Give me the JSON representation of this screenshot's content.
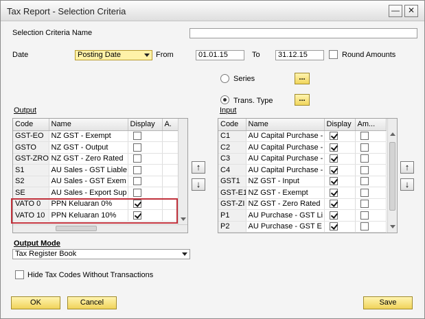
{
  "window": {
    "title": "Tax Report - Selection Criteria"
  },
  "criteria": {
    "name_label": "Selection Criteria Name",
    "name_value": "",
    "date_label": "Date",
    "date_type": "Posting Date",
    "from_label": "From",
    "from_value": "01.01.15",
    "to_label": "To",
    "to_value": "31.12.15",
    "round_amounts_label": "Round Amounts",
    "round_amounts_checked": false,
    "series_label": "Series",
    "trans_type_label": "Trans. Type",
    "selected_radio": "trans_type",
    "ellipsis": "..."
  },
  "output": {
    "heading": "Output",
    "columns": [
      "Code",
      "Name",
      "Display",
      "A."
    ],
    "rows": [
      {
        "code": "GST-EO",
        "name": "NZ GST - Exempt",
        "display": false
      },
      {
        "code": "GSTO",
        "name": "NZ GST - Output",
        "display": false
      },
      {
        "code": "GST-ZRO",
        "name": "NZ GST - Zero Rated",
        "display": false
      },
      {
        "code": "S1",
        "name": "AU Sales - GST Liable",
        "display": false
      },
      {
        "code": "S2",
        "name": "AU Sales - GST Exem",
        "display": false
      },
      {
        "code": "SE",
        "name": "AU Sales - Export Sup",
        "display": false
      },
      {
        "code": "VATO 0",
        "name": "PPN Keluaran 0%",
        "display": true
      },
      {
        "code": "VATO 10",
        "name": "PPN Keluaran 10%",
        "display": true
      }
    ]
  },
  "input": {
    "heading": "Input",
    "columns": [
      "Code",
      "Name",
      "Display",
      "Am..."
    ],
    "rows": [
      {
        "code": "C1",
        "name": "AU Capital Purchase -",
        "display": true
      },
      {
        "code": "C2",
        "name": "AU Capital Purchase -",
        "display": true
      },
      {
        "code": "C3",
        "name": "AU Capital Purchase -",
        "display": true
      },
      {
        "code": "C4",
        "name": "AU Capital Purchase -",
        "display": true
      },
      {
        "code": "GST1",
        "name": "NZ GST - Input",
        "display": true
      },
      {
        "code": "GST-E1",
        "name": "NZ GST - Exempt",
        "display": true
      },
      {
        "code": "GST-ZI",
        "name": "NZ GST - Zero Rated",
        "display": true
      },
      {
        "code": "P1",
        "name": "AU Purchase - GST Li",
        "display": true
      },
      {
        "code": "P2",
        "name": "AU Purchase - GST E",
        "display": true
      }
    ]
  },
  "move": {
    "up": "↑",
    "down": "↓"
  },
  "output_mode": {
    "label": "Output Mode",
    "value": "Tax Register Book"
  },
  "hide_tax_codes": {
    "label": "Hide Tax Codes Without Transactions",
    "checked": false
  },
  "buttons": {
    "ok": "OK",
    "cancel": "Cancel",
    "save": "Save"
  },
  "colors": {
    "accent_yellow": "#f0d35a",
    "highlight_red": "#c0303b"
  }
}
